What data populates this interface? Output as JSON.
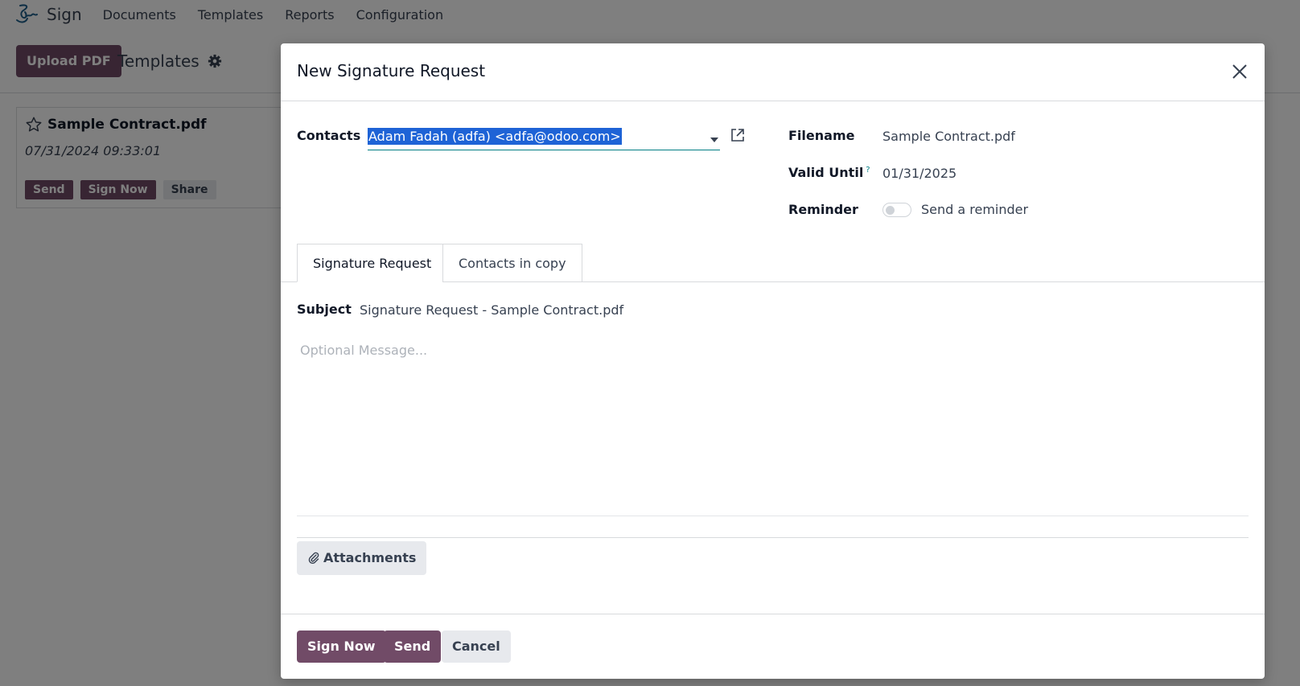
{
  "app": {
    "name": "Sign",
    "menu": [
      "Documents",
      "Templates",
      "Reports",
      "Configuration"
    ]
  },
  "controlbar": {
    "upload_label": "Upload PDF",
    "breadcrumb": "Templates"
  },
  "card": {
    "title": "Sample Contract.pdf",
    "date": "07/31/2024 09:33:01",
    "actions": [
      "Send",
      "Sign Now",
      "Share"
    ]
  },
  "modal": {
    "title": "New Signature Request",
    "contacts_label": "Contacts",
    "contacts_value": "Adam Fadah (adfa) <adfa@odoo.com>",
    "filename_label": "Filename",
    "filename_value": "Sample Contract.pdf",
    "valid_until_label": "Valid Until",
    "valid_until_help": "?",
    "valid_until_value": "01/31/2025",
    "reminder_label": "Reminder",
    "reminder_text": "Send a reminder",
    "reminder_enabled": false,
    "tabs": [
      "Signature Request",
      "Contacts in copy"
    ],
    "subject_label": "Subject",
    "subject_value": "Signature Request - Sample Contract.pdf",
    "message_placeholder": "Optional Message...",
    "attachments_label": "Attachments",
    "footer": {
      "sign_now": "Sign Now",
      "send": "Send",
      "cancel": "Cancel"
    }
  },
  "colors": {
    "primary": "#714B67",
    "accent": "#017e84",
    "selection": "#1e63d6"
  }
}
